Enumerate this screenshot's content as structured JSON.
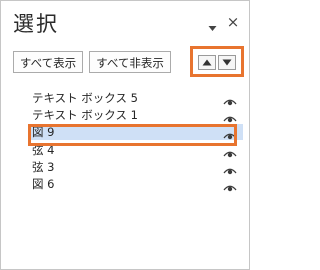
{
  "pane": {
    "title": "選択",
    "menu_icon": "dropdown-triangle-icon",
    "close_label": "×"
  },
  "toolbar": {
    "show_all_label": "すべて表示",
    "hide_all_label": "すべて非表示",
    "bring_forward_icon": "triangle-up-icon",
    "send_backward_icon": "triangle-down-icon"
  },
  "objects": [
    {
      "label": "テキスト ボックス 5",
      "visible": true,
      "selected": false
    },
    {
      "label": "テキスト ボックス 1",
      "visible": true,
      "selected": false
    },
    {
      "label": "図 9",
      "visible": true,
      "selected": true
    },
    {
      "label": "弦 4",
      "visible": true,
      "selected": false
    },
    {
      "label": "弦 3",
      "visible": true,
      "selected": false
    },
    {
      "label": "図 6",
      "visible": true,
      "selected": false
    }
  ],
  "colors": {
    "highlight_border": "#e8742f",
    "selected_row": "#cfe0f6",
    "text": "#262626"
  }
}
